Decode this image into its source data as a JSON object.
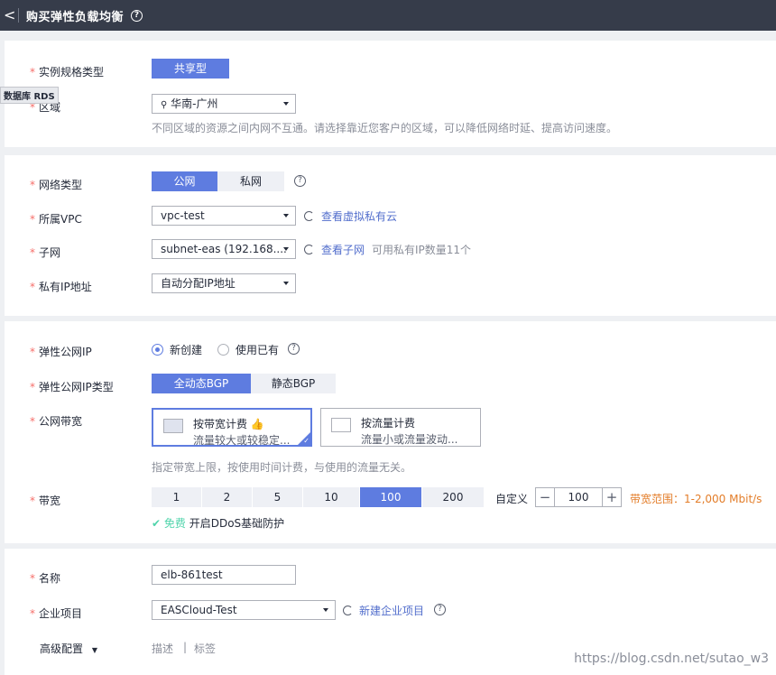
{
  "header": {
    "back": "<",
    "title": "购买弹性负载均衡",
    "help": "?"
  },
  "tooltip": "数据库 RDS",
  "spec": {
    "label": "实例规格类型",
    "value": "共享型"
  },
  "region": {
    "label": "区域",
    "value": "华南-广州",
    "hint": "不同区域的资源之间内网不互通。请选择靠近您客户的区域，可以降低网络时延、提高访问速度。"
  },
  "network": {
    "type_label": "网络类型",
    "type_public": "公网",
    "type_private": "私网",
    "vpc_label": "所属VPC",
    "vpc_value": "vpc-test",
    "vpc_link": "查看虚拟私有云",
    "subnet_label": "子网",
    "subnet_value": "subnet-eas (192.168....",
    "subnet_link": "查看子网",
    "subnet_hint": "可用私有IP数量11个",
    "ip_label": "私有IP地址",
    "ip_value": "自动分配IP地址"
  },
  "eip": {
    "label": "弹性公网IP",
    "opt_new": "新创建",
    "opt_existing": "使用已有",
    "type_label": "弹性公网IP类型",
    "type_dynamic": "全动态BGP",
    "type_static": "静态BGP",
    "bw_type_label": "公网带宽",
    "bill_bw_title": "按带宽计费",
    "bill_bw_desc": "流量较大或较稳定...",
    "bill_traffic_title": "按流量计费",
    "bill_traffic_desc": "流量小或流量波动...",
    "bill_hint": "指定带宽上限，按使用时间计费，与使用的流量无关。",
    "bw_label": "带宽",
    "bw_options": [
      "1",
      "2",
      "5",
      "10",
      "100",
      "200"
    ],
    "bw_selected": "100",
    "custom_label": "自定义",
    "minus": "−",
    "bw_value": "100",
    "plus": "+",
    "range_text": "带宽范围：1-2,000 Mbit/s",
    "ddos_free": "免费",
    "ddos_text": "开启DDoS基础防护"
  },
  "basic": {
    "name_label": "名称",
    "name_value": "elb-861test",
    "project_label": "企业项目",
    "project_value": "EASCloud-Test",
    "project_link": "新建企业项目",
    "advanced_label": "高级配置",
    "desc_label": "描述",
    "divider": "|",
    "tag_label": "标签"
  },
  "watermark": "https://blog.csdn.net/sutao_w3",
  "colors": {
    "primary": "#5e7ce0",
    "required": "#f66f6a",
    "warning": "#e37d29",
    "success": "#50d4ab",
    "header_bg": "#363c4a"
  }
}
